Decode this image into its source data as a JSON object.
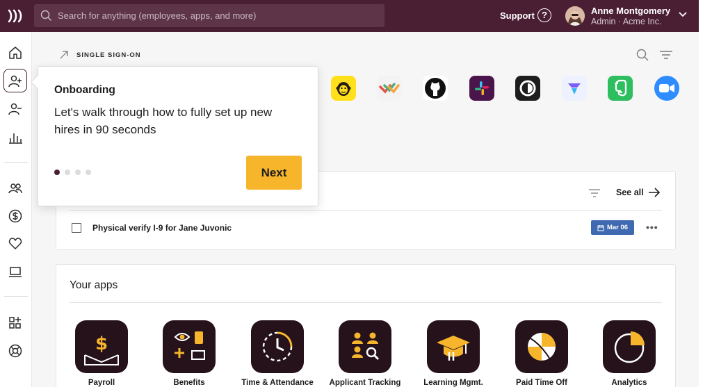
{
  "search": {
    "placeholder": "Search for anything (employees, apps, and more)"
  },
  "header": {
    "support_label": "Support",
    "help_glyph": "?",
    "user_name": "Anne Montgomery",
    "user_role": "Admin · Acme Inc."
  },
  "sidebar": {
    "items": [
      {
        "icon": "home-icon"
      },
      {
        "icon": "add-person-icon",
        "active": true
      },
      {
        "icon": "remove-person-icon"
      },
      {
        "icon": "bar-chart-icon"
      },
      {
        "icon": "people-icon"
      },
      {
        "icon": "dollar-icon"
      },
      {
        "icon": "heart-icon"
      },
      {
        "icon": "laptop-icon"
      },
      {
        "icon": "apps-add-icon"
      },
      {
        "icon": "lifebuoy-icon"
      }
    ]
  },
  "sso": {
    "label": "SINGLE SIGN-ON",
    "apps": [
      {
        "icon": "mailchimp-icon",
        "bg": "#ffe01b"
      },
      {
        "icon": "smartsheet-like-icon",
        "bg": "#f3f3f3"
      },
      {
        "icon": "github-icon",
        "bg": "#ffffff"
      },
      {
        "icon": "slack-icon",
        "bg": "#4a154b"
      },
      {
        "icon": "okta-like-icon",
        "bg": "#1d1d1d"
      },
      {
        "icon": "linear-like-icon",
        "bg": "#eef1ff"
      },
      {
        "icon": "evernote-icon",
        "bg": "#2dbe60"
      },
      {
        "icon": "zoom-icon",
        "bg": "#2d8cff"
      }
    ]
  },
  "tasks": {
    "see_all_label": "See all",
    "items": [
      {
        "text": "Physical verify I-9 for Jane Juvonic",
        "date": "Mar 06"
      }
    ],
    "more_glyph": "•••"
  },
  "apps": {
    "title": "Your apps",
    "items": [
      {
        "label": "Payroll",
        "icon": "payroll-icon"
      },
      {
        "label": "Benefits",
        "icon": "benefits-icon"
      },
      {
        "label": "Time & Attendance",
        "icon": "clock-icon"
      },
      {
        "label": "Applicant Tracking",
        "icon": "applicant-icon"
      },
      {
        "label": "Learning Mgmt.",
        "icon": "graduation-cap-icon"
      },
      {
        "label": "Paid Time Off",
        "icon": "beach-ball-icon"
      },
      {
        "label": "Analytics",
        "icon": "pie-chart-icon"
      }
    ]
  },
  "onboarding": {
    "title": "Onboarding",
    "body": "Let's walk through how to fully set up new hires in 90 seconds",
    "steps": 4,
    "current_step": 1,
    "next_label": "Next"
  },
  "colors": {
    "topbar": "#4a1f34",
    "accent": "#f7b52c",
    "date_badge": "#3f69b0",
    "app_tile": "#25121b",
    "app_icon": "#f7b52c"
  }
}
